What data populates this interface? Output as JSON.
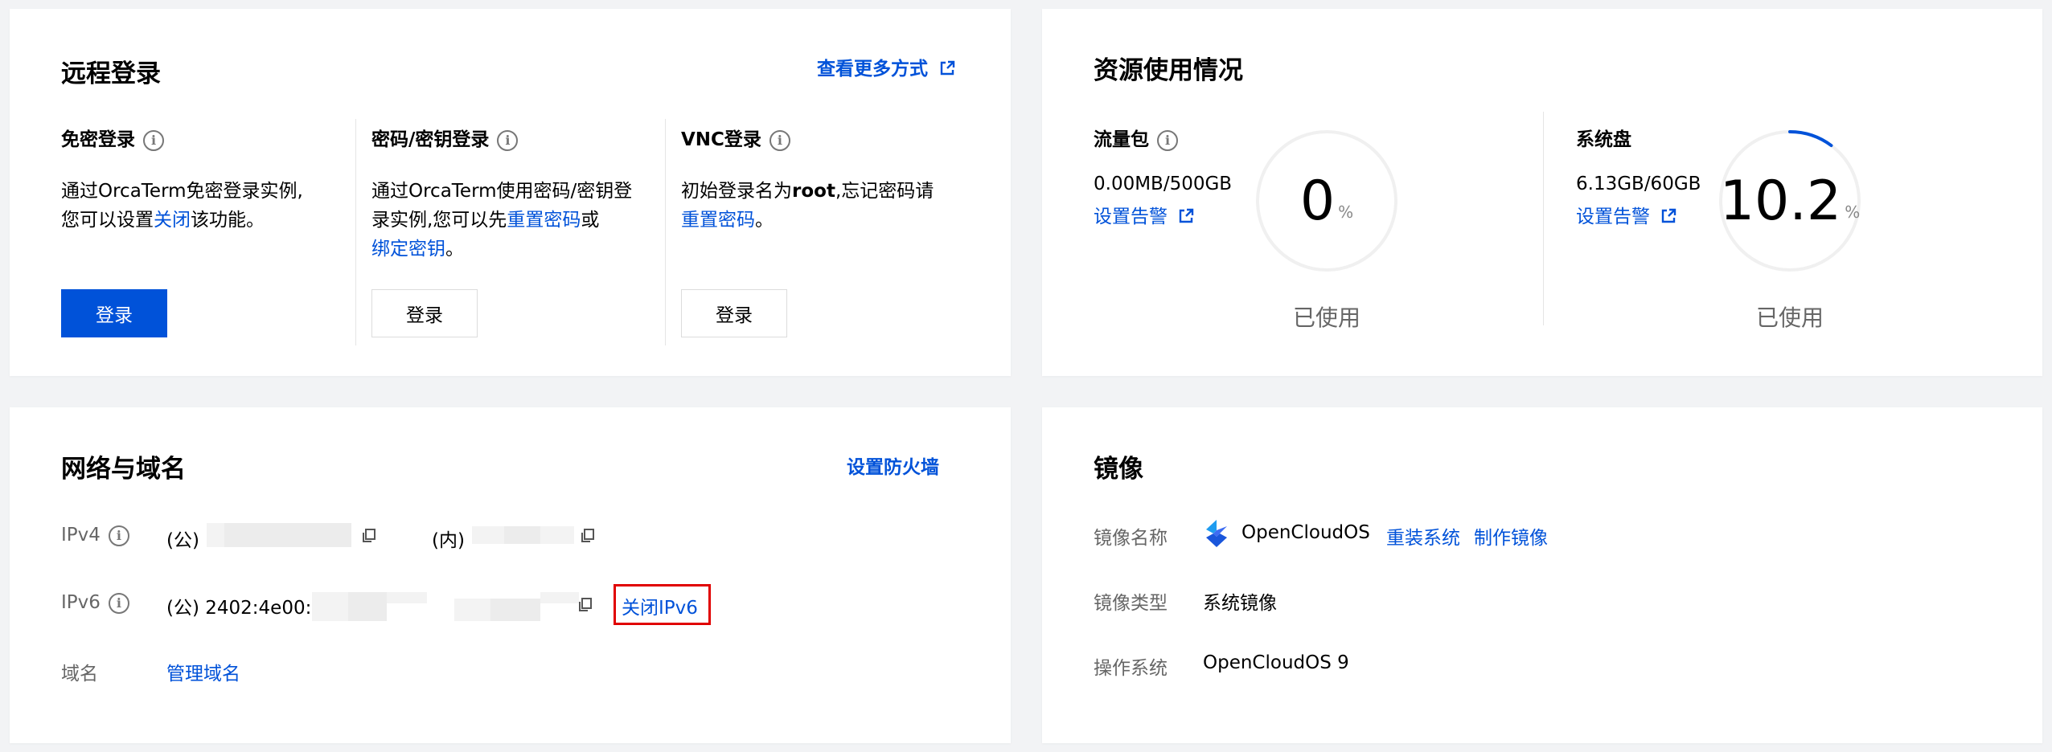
{
  "remote_login": {
    "title": "远程登录",
    "more_link": "查看更多方式",
    "columns": [
      {
        "title": "免密登录",
        "desc_before": "通过OrcaTerm免密登录实例,",
        "desc_line2_before": "您可以设置",
        "desc_link": "关闭",
        "desc_after": "该功能。",
        "button": "登录"
      },
      {
        "title": "密码/密钥登录",
        "desc_line1": "通过OrcaTerm使用密码/密钥登",
        "desc_line2_before": "录实例,您可以先",
        "desc_link1": "重置密码",
        "desc_mid": "或",
        "desc_link2": "绑定密钥",
        "desc_after": "。",
        "button": "登录"
      },
      {
        "title": "VNC登录",
        "desc_before": "初始登录名为",
        "desc_bold": "root",
        "desc_after": ",忘记密码请",
        "desc_link": "重置密码",
        "desc_end": "。",
        "button": "登录"
      }
    ]
  },
  "resource": {
    "title": "资源使用情况",
    "traffic": {
      "label": "流量包",
      "amount": "0.00MB/500GB",
      "alert_link": "设置告警",
      "value": "0",
      "unit": "%",
      "caption": "已使用",
      "percent": 0
    },
    "disk": {
      "label": "系统盘",
      "amount": "6.13GB/60GB",
      "alert_link": "设置告警",
      "value": "10.2",
      "unit": "%",
      "caption": "已使用",
      "percent": 10.2
    }
  },
  "network": {
    "title": "网络与域名",
    "firewall_link": "设置防火墙",
    "ipv4_label": "IPv4",
    "ipv4_public_prefix": "(公)",
    "ipv4_private_prefix": "(内)",
    "ipv6_label": "IPv6",
    "ipv6_prefix": "(公) 2402:4e00:",
    "ipv6_close_link": "关闭IPv6",
    "domain_label": "域名",
    "domain_link": "管理域名"
  },
  "image": {
    "title": "镜像",
    "name_label": "镜像名称",
    "name_value": "OpenCloudOS",
    "reinstall_link": "重装系统",
    "make_link": "制作镜像",
    "type_label": "镜像类型",
    "type_value": "系统镜像",
    "os_label": "操作系统",
    "os_value": "OpenCloudOS 9"
  },
  "colors": {
    "primary": "#0052d9",
    "highlight": "#e00000",
    "ring_track": "#f0f0f0"
  }
}
